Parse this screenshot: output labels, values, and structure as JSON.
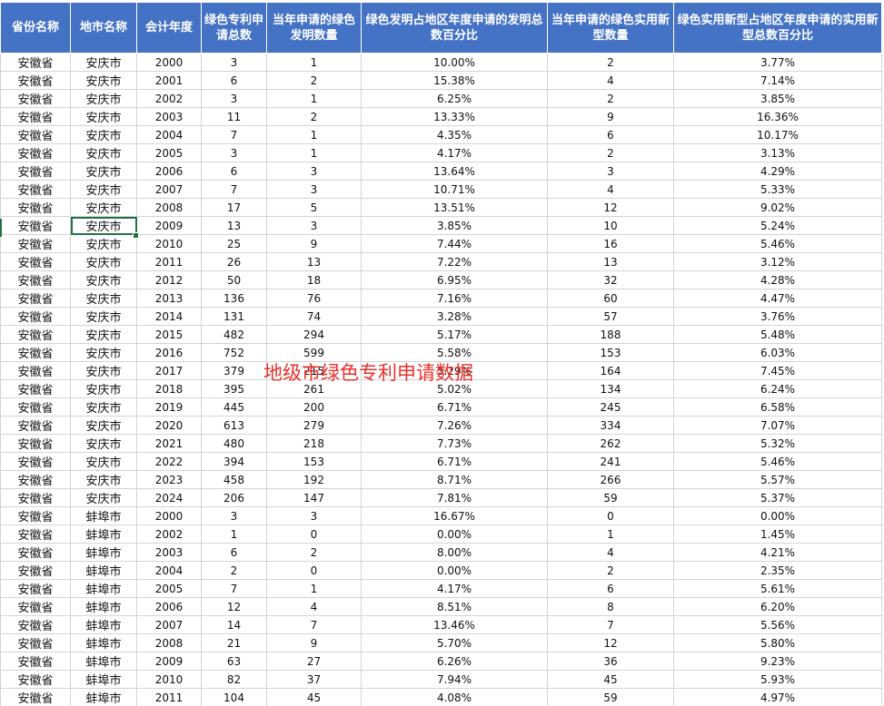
{
  "columns": [
    "省份名称",
    "地市名称",
    "会计年度",
    "绿色专利申请总数",
    "当年申请的绿色发明数量",
    "绿色发明占地区年度申请的发明总数百分比",
    "当年申请的绿色实用新型数量",
    "绿色实用新型占地区年度申请的实用新型总数百分比"
  ],
  "rows": [
    [
      "安徽省",
      "安庆市",
      "2000",
      "3",
      "1",
      "10.00%",
      "2",
      "3.77%"
    ],
    [
      "安徽省",
      "安庆市",
      "2001",
      "6",
      "2",
      "15.38%",
      "4",
      "7.14%"
    ],
    [
      "安徽省",
      "安庆市",
      "2002",
      "3",
      "1",
      "6.25%",
      "2",
      "3.85%"
    ],
    [
      "安徽省",
      "安庆市",
      "2003",
      "11",
      "2",
      "13.33%",
      "9",
      "16.36%"
    ],
    [
      "安徽省",
      "安庆市",
      "2004",
      "7",
      "1",
      "4.35%",
      "6",
      "10.17%"
    ],
    [
      "安徽省",
      "安庆市",
      "2005",
      "3",
      "1",
      "4.17%",
      "2",
      "3.13%"
    ],
    [
      "安徽省",
      "安庆市",
      "2006",
      "6",
      "3",
      "13.64%",
      "3",
      "4.29%"
    ],
    [
      "安徽省",
      "安庆市",
      "2007",
      "7",
      "3",
      "10.71%",
      "4",
      "5.33%"
    ],
    [
      "安徽省",
      "安庆市",
      "2008",
      "17",
      "5",
      "13.51%",
      "12",
      "9.02%"
    ],
    [
      "安徽省",
      "安庆市",
      "2009",
      "13",
      "3",
      "3.85%",
      "10",
      "5.24%"
    ],
    [
      "安徽省",
      "安庆市",
      "2010",
      "25",
      "9",
      "7.44%",
      "16",
      "5.46%"
    ],
    [
      "安徽省",
      "安庆市",
      "2011",
      "26",
      "13",
      "7.22%",
      "13",
      "3.12%"
    ],
    [
      "安徽省",
      "安庆市",
      "2012",
      "50",
      "18",
      "6.95%",
      "32",
      "4.28%"
    ],
    [
      "安徽省",
      "安庆市",
      "2013",
      "136",
      "76",
      "7.16%",
      "60",
      "4.47%"
    ],
    [
      "安徽省",
      "安庆市",
      "2014",
      "131",
      "74",
      "3.28%",
      "57",
      "3.76%"
    ],
    [
      "安徽省",
      "安庆市",
      "2015",
      "482",
      "294",
      "5.17%",
      "188",
      "5.48%"
    ],
    [
      "安徽省",
      "安庆市",
      "2016",
      "752",
      "599",
      "5.58%",
      "153",
      "6.03%"
    ],
    [
      "安徽省",
      "安庆市",
      "2017",
      "379",
      "215",
      "5.29%",
      "164",
      "7.45%"
    ],
    [
      "安徽省",
      "安庆市",
      "2018",
      "395",
      "261",
      "5.02%",
      "134",
      "6.24%"
    ],
    [
      "安徽省",
      "安庆市",
      "2019",
      "445",
      "200",
      "6.71%",
      "245",
      "6.58%"
    ],
    [
      "安徽省",
      "安庆市",
      "2020",
      "613",
      "279",
      "7.26%",
      "334",
      "7.07%"
    ],
    [
      "安徽省",
      "安庆市",
      "2021",
      "480",
      "218",
      "7.73%",
      "262",
      "5.32%"
    ],
    [
      "安徽省",
      "安庆市",
      "2022",
      "394",
      "153",
      "6.71%",
      "241",
      "5.46%"
    ],
    [
      "安徽省",
      "安庆市",
      "2023",
      "458",
      "192",
      "8.71%",
      "266",
      "5.57%"
    ],
    [
      "安徽省",
      "安庆市",
      "2024",
      "206",
      "147",
      "7.81%",
      "59",
      "5.37%"
    ],
    [
      "安徽省",
      "蚌埠市",
      "2000",
      "3",
      "3",
      "16.67%",
      "0",
      "0.00%"
    ],
    [
      "安徽省",
      "蚌埠市",
      "2002",
      "1",
      "0",
      "0.00%",
      "1",
      "1.45%"
    ],
    [
      "安徽省",
      "蚌埠市",
      "2003",
      "6",
      "2",
      "8.00%",
      "4",
      "4.21%"
    ],
    [
      "安徽省",
      "蚌埠市",
      "2004",
      "2",
      "0",
      "0.00%",
      "2",
      "2.35%"
    ],
    [
      "安徽省",
      "蚌埠市",
      "2005",
      "7",
      "1",
      "4.17%",
      "6",
      "5.61%"
    ],
    [
      "安徽省",
      "蚌埠市",
      "2006",
      "12",
      "4",
      "8.51%",
      "8",
      "6.20%"
    ],
    [
      "安徽省",
      "蚌埠市",
      "2007",
      "14",
      "7",
      "13.46%",
      "7",
      "5.56%"
    ],
    [
      "安徽省",
      "蚌埠市",
      "2008",
      "21",
      "9",
      "5.70%",
      "12",
      "5.80%"
    ],
    [
      "安徽省",
      "蚌埠市",
      "2009",
      "63",
      "27",
      "6.26%",
      "36",
      "9.23%"
    ],
    [
      "安徽省",
      "蚌埠市",
      "2010",
      "82",
      "37",
      "7.94%",
      "45",
      "5.93%"
    ],
    [
      "安徽省",
      "蚌埠市",
      "2011",
      "104",
      "45",
      "4.08%",
      "59",
      "4.97%"
    ]
  ],
  "selected_cell": {
    "row": 9,
    "col": 1
  },
  "watermark": "地级市绿色专利申请数据",
  "colors": {
    "header_bg": "#4472c4",
    "header_text": "#ffffff",
    "grid_line": "#d4d4d4",
    "selection": "#217346",
    "watermark": "#e8302c"
  }
}
